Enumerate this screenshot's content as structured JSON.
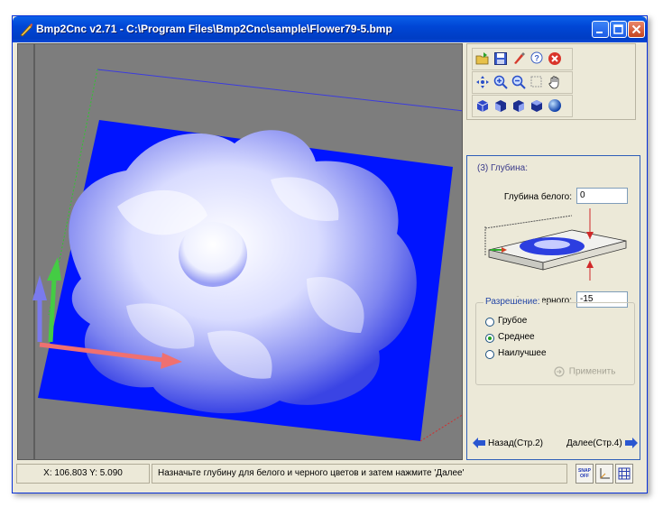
{
  "window": {
    "title": "Bmp2Cnc v2.71 - C:\\Program Files\\Bmp2Cnc\\sample\\Flower79-5.bmp",
    "accent": "#0046d5"
  },
  "toolbar": {
    "row1": [
      "open-icon",
      "save-icon",
      "pen-icon",
      "help-icon",
      "stop-icon"
    ],
    "row2": [
      "move-icon",
      "zoom-in-icon",
      "zoom-out-icon",
      "zoom-window-icon",
      "pan-hand-icon"
    ],
    "row3": [
      "view-front-icon",
      "view-left-icon",
      "view-right-icon",
      "view-top-icon",
      "sphere-icon"
    ]
  },
  "panel": {
    "step_title": "(3) Глубина:",
    "white_depth_label": "Глубина белого:",
    "white_depth_value": "0",
    "black_depth_label": "Глубина черного:",
    "black_depth_value": "-15",
    "resolution": {
      "legend": "Разрешение:",
      "options": [
        "Грубое",
        "Среднее",
        "Наилучшее"
      ],
      "selected": "Среднее"
    },
    "apply_label": "Применить",
    "back_label": "Назад(Стр.2)",
    "next_label": "Далее(Стр.4)"
  },
  "status": {
    "coords": "X: 106.803 Y:  5.090",
    "hint": "Назначьте глубину для белого и черного цветов и затем нажмите 'Далее'",
    "snap_label": "SNAP OFF"
  },
  "colors": {
    "viewport_bg": "#7d7d7d",
    "model_blue": "#0014ff",
    "panel_border": "#2f5fb8"
  }
}
